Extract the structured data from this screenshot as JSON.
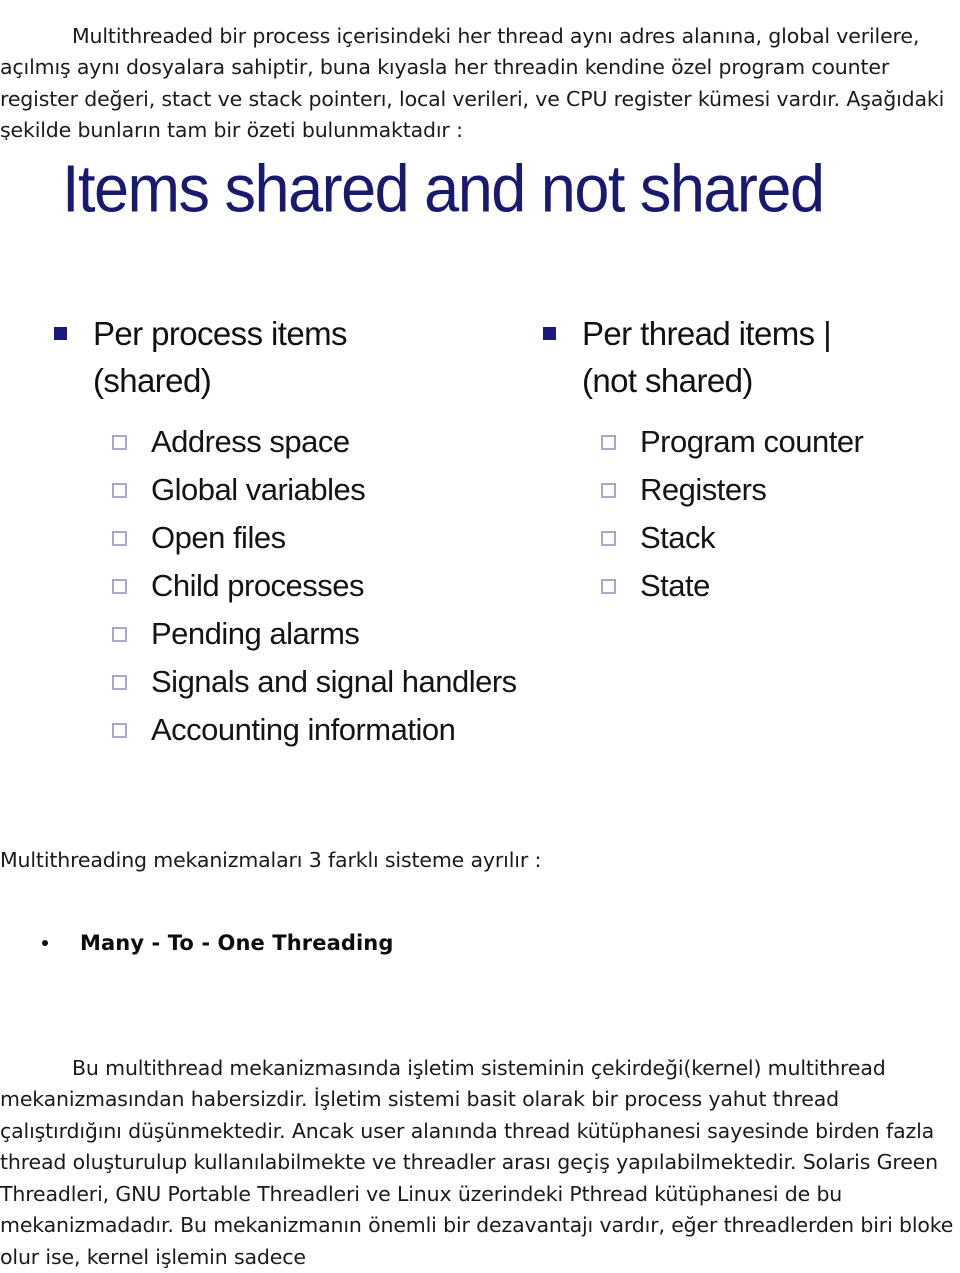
{
  "document": {
    "intro_paragraph": "Multithreaded bir process içerisindeki her thread aynı adres alanına, global verilere, açılmış aynı dosyalara sahiptir, buna kıyasla her threadin kendine özel program counter register değeri, stact ve stack pointerı, local verileri, ve CPU register kümesi vardır. Aşağıdaki şekilde bunların tam bir özeti bulunmaktadır :",
    "mid_line": "Multithreading mekanizmaları 3 farklı sisteme ayrılır :",
    "bullet_heading": "Many - To - One Threading",
    "body_paragraph": "Bu multithread mekanizmasında işletim sisteminin çekirdeği(kernel) multithread mekanizmasından habersizdir. İşletim sistemi basit olarak bir process yahut thread çalıştırdığını düşünmektedir. Ancak user alanında thread kütüphanesi sayesinde birden fazla thread oluşturulup kullanılabilmekte ve threadler arası geçiş yapılabilmektedir. Solaris Green Threadleri, GNU Portable Threadleri ve Linux üzerindeki Pthread kütüphanesi de bu mekanizmadadır. Bu mekanizmanın önemli bir dezavantajı vardır, eğer threadlerden biri bloke olur ise, kernel işlemin sadece"
  },
  "figure": {
    "title": "Items shared and not shared",
    "title_color": "#191970",
    "bullet_square_color": "#19197f",
    "checkbox_border_color": "#a8a8c8",
    "columns": [
      {
        "heading_line1": "Per process items",
        "heading_line2": "(shared)",
        "items": [
          "Address space",
          "Global variables",
          "Open files",
          "Child processes",
          "Pending alarms",
          "Signals and signal handlers",
          "Accounting information"
        ]
      },
      {
        "heading_line1": "Per thread items |",
        "heading_line2": "(not shared)",
        "items": [
          "Program counter",
          "Registers",
          "Stack",
          "State"
        ]
      }
    ]
  }
}
